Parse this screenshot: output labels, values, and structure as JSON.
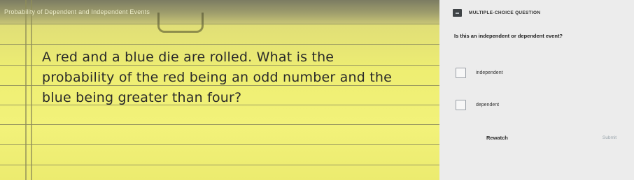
{
  "video": {
    "title": "Probability of Dependent and Independent Events",
    "problem_lines": [
      "A red and a blue die are rolled.  What is the",
      "probability of the red being an odd number and the",
      "blue being greater than four?"
    ]
  },
  "panel": {
    "question_type": "MULTIPLE-CHOICE QUESTION",
    "question": "Is this an independent or dependent event?",
    "choices": [
      {
        "label": "independent",
        "selected": false
      },
      {
        "label": "dependent",
        "selected": false
      }
    ],
    "rewatch_label": "Rewatch",
    "submit_label": "Submit"
  }
}
